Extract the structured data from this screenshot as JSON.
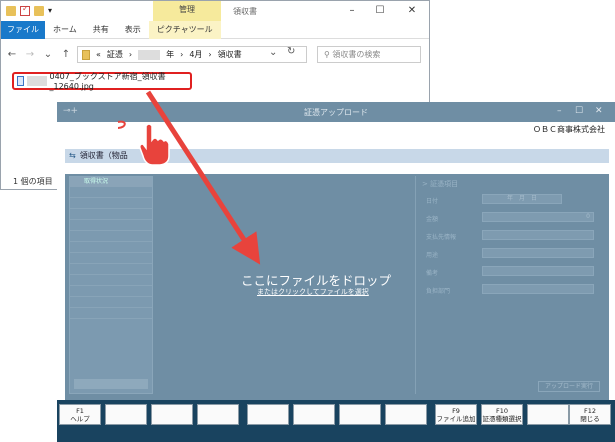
{
  "explorer": {
    "manage_tab": "管理",
    "title": "領収書",
    "ribbon_tabs": [
      "ファイル",
      "ホーム",
      "共有",
      "表示",
      "ピクチャツール"
    ],
    "breadcrumb": [
      "«",
      "証憑",
      "›",
      "年",
      "›",
      "4月",
      "›",
      "領収書"
    ],
    "search_placeholder": "領収書の検索",
    "file_name": "0407_ブックストア新宿_領収書_12640.jpg",
    "item_count": "1 個の項目"
  },
  "app": {
    "title": "証憑アップロード",
    "company": "ＯＢＣ商事株式会社",
    "doc_header": "領収書（物品",
    "drop_main": "ここにファイルをドロップ",
    "drop_sub": "またはクリックしてファイルを選択",
    "left_panel_header": "取得状況",
    "right_panel": {
      "title": "証憑項目",
      "rows": [
        "日付",
        "金額",
        "支払先情報",
        "用途",
        "備考",
        "負担部門"
      ],
      "date_parts": "年　月　日",
      "amount": "0",
      "upload_button": "アップロード実行"
    },
    "fkeys": [
      {
        "key": "F1",
        "label": "ヘルプ"
      },
      {
        "key": "",
        "label": ""
      },
      {
        "key": "",
        "label": ""
      },
      {
        "key": "",
        "label": ""
      },
      {
        "key": "",
        "label": ""
      },
      {
        "key": "",
        "label": ""
      },
      {
        "key": "",
        "label": ""
      },
      {
        "key": "",
        "label": ""
      },
      {
        "key": "F9",
        "label": "ファイル追加"
      },
      {
        "key": "F10",
        "label": "証憑種類選択"
      },
      {
        "key": "",
        "label": ""
      },
      {
        "key": "F12",
        "label": "閉じる"
      }
    ]
  },
  "colors": {
    "accent_red": "#e02020",
    "app_dark": "#19435f",
    "overlay": "#6f8ea4",
    "file_tab": "#1979ca"
  }
}
